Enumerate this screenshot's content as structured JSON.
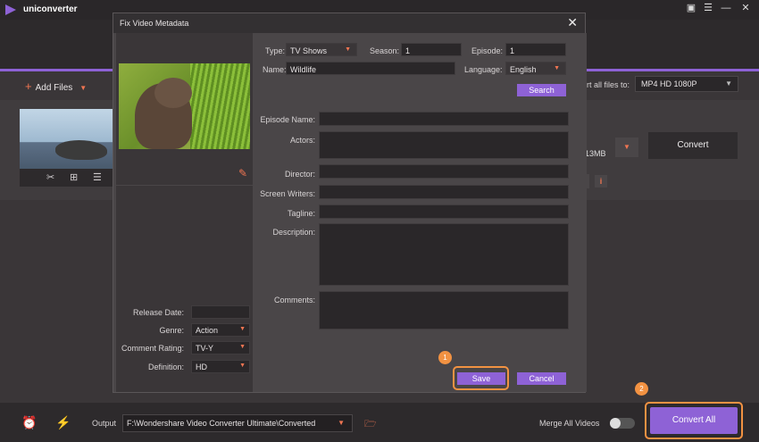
{
  "app": {
    "name": "uniconverter"
  },
  "toolbar": {
    "add_files_label": "Add Files",
    "convert_all_to_label": "ert all files to:",
    "format_value": "MP4 HD 1080P"
  },
  "file_item": {
    "size_text": "13MB",
    "convert_label": "Convert",
    "info_label": "i"
  },
  "dialog": {
    "title": "Fix Video Metadata",
    "type_label": "Type:",
    "type_value": "TV Shows",
    "season_label": "Season:",
    "season_value": "1",
    "episode_label": "Episode:",
    "episode_value": "1",
    "name_label": "Name:",
    "name_value": "Wildlife",
    "language_label": "Language:",
    "language_value": "English",
    "search_label": "Search",
    "episode_name_label": "Episode Name:",
    "actors_label": "Actors:",
    "director_label": "Director:",
    "screen_writers_label": "Screen Writers:",
    "tagline_label": "Tagline:",
    "description_label": "Description:",
    "comments_label": "Comments:",
    "release_date_label": "Release Date:",
    "release_date_value": "",
    "genre_label": "Genre:",
    "genre_value": "Action",
    "comment_rating_label": "Comment Rating:",
    "comment_rating_value": "TV-Y",
    "definition_label": "Definition:",
    "definition_value": "HD",
    "save_label": "Save",
    "cancel_label": "Cancel"
  },
  "bottom": {
    "output_label": "Output",
    "output_path": "F:\\Wondershare Video Converter Ultimate\\Converted",
    "merge_label": "Merge All Videos",
    "convert_all_label": "Convert All"
  },
  "steps": {
    "one": "1",
    "two": "2"
  },
  "colors": {
    "accent": "#8e62d6",
    "highlight": "#f29242",
    "icon_accent": "#f07552"
  }
}
